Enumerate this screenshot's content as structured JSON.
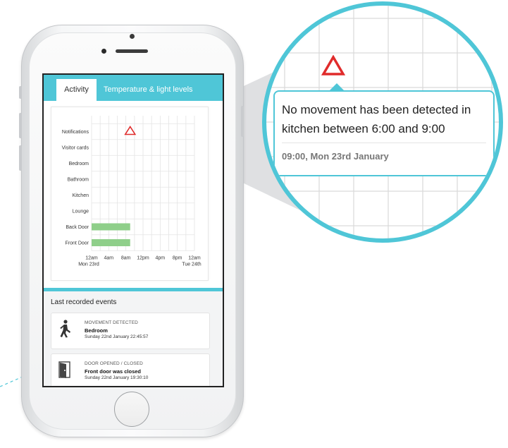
{
  "tabs": {
    "active": "Activity",
    "other": "Temperature & light levels"
  },
  "chart_data": {
    "type": "timeline",
    "rows": [
      "Notifications",
      "Visitor cards",
      "Bedroom",
      "Bathroom",
      "Kitchen",
      "Lounge",
      "Back Door",
      "Front Door"
    ],
    "x_ticks": [
      "12am",
      "4am",
      "8am",
      "12pm",
      "4pm",
      "8pm",
      "12am"
    ],
    "x_start_label": "Mon 23rd",
    "x_end_label": "Tue 24th",
    "x_range_hours": [
      0,
      24
    ],
    "grid": true,
    "activity_bars": [
      {
        "row": "Back Door",
        "start_hour": 0,
        "end_hour": 9,
        "color": "#8fcf8a"
      },
      {
        "row": "Front Door",
        "start_hour": 0,
        "end_hour": 9,
        "color": "#8fcf8a"
      }
    ],
    "markers": [
      {
        "row": "Notifications",
        "hour": 9,
        "kind": "warning-triangle",
        "color": "#e02b2b"
      }
    ]
  },
  "events": {
    "title": "Last recorded events",
    "items": [
      {
        "type": "MOVEMENT DETECTED",
        "title": "Bedroom",
        "time": "Sunday 22nd January 22:45:57",
        "icon": "walking-person-icon"
      },
      {
        "type": "DOOR OPENED / CLOSED",
        "title": "Front door was closed",
        "time": "Sunday 22nd January 19:30:10",
        "icon": "door-icon"
      }
    ]
  },
  "popup": {
    "message": "No movement has been detected in kitchen between 6:00 and 9:00",
    "time": "09:00, Mon 23rd January"
  },
  "colors": {
    "accent": "#4fc6d7",
    "warning": "#e02b2b",
    "bar": "#8fcf8a"
  }
}
